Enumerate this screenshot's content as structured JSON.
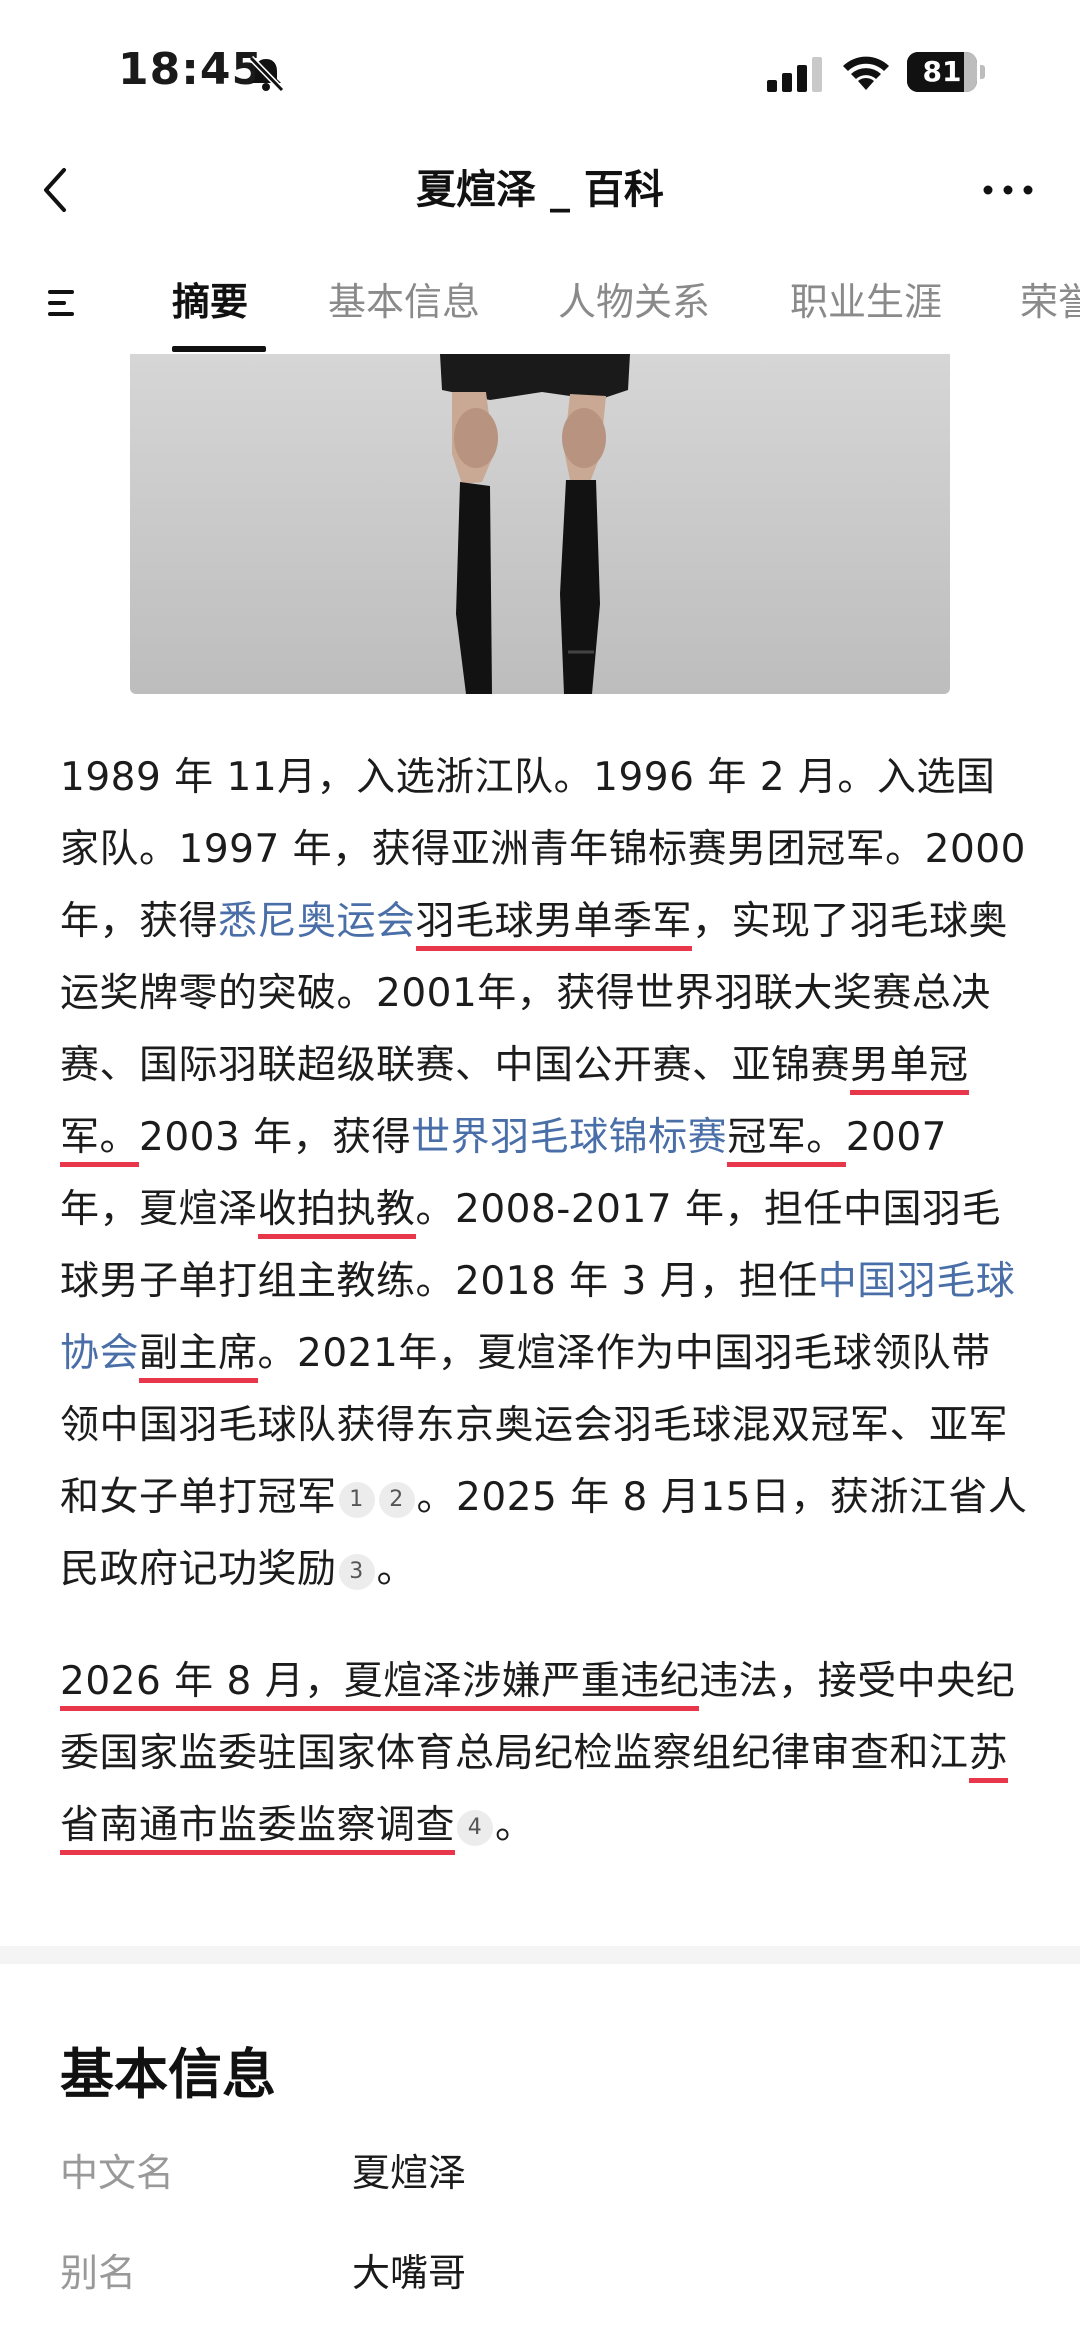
{
  "status_bar": {
    "time": "18:45",
    "battery": "81",
    "battery_level": 0.81,
    "icons": [
      "bell-slash-icon",
      "signal-icon",
      "wifi-icon",
      "battery-icon"
    ]
  },
  "header": {
    "title": "夏煊泽 _ 百科",
    "icons": [
      "back-arrow-icon",
      "more-dots-icon"
    ]
  },
  "tabs": [
    {
      "label": "摘要",
      "active": true
    },
    {
      "label": "基本信息",
      "active": false
    },
    {
      "label": "人物关系",
      "active": false
    },
    {
      "label": "职业生涯",
      "active": false
    },
    {
      "label": "荣誉",
      "active": false
    }
  ],
  "article": {
    "p1": {
      "t1": "1989 年 11月，入选浙江队。1996 年 2 月。入选国家队。1997 年，获得亚洲青年锦标赛男团冠军。2000年，获得",
      "link1": "悉尼奥运会",
      "hl1": "羽毛球男单季军",
      "t2": "，实现了羽毛球奥运奖牌零的突破。2001年，获得世界羽联大奖赛总决赛、国际羽联超级联赛、中国公开赛、亚锦赛",
      "hl2": "男单冠军。",
      "t3": "2003 年，获得",
      "link2": "世界羽毛球锦标赛",
      "hl3": "冠军。",
      "t4": "2007 年，夏煊泽",
      "hl4": "收拍执教",
      "t5": "。2008-2017 年，担任中国羽毛球男子单打组主教练。2018 年 3 月，担任",
      "link3": "中国羽毛球协会",
      "hl5": "副主席",
      "t6": "。2021年，夏煊泽作为中国羽毛球领队带领中国羽毛球队获得东京奥运会羽毛球混双冠军、亚军和女子单打冠军",
      "cite1": "1",
      "cite2": "2",
      "t7": "。2025 年 8 月15日，获浙江省人民政府记功奖励",
      "cite3": "3",
      "t8": "。"
    },
    "p2": {
      "hl1": "2026 年 8 月，夏煊泽涉嫌严重违纪",
      "t1": "违法，接受中央纪委国家监委驻国家体育总局纪检监察组纪律审查和江",
      "hl2": "苏省南通市监委监察调查",
      "cite4": "4",
      "t2": "。"
    }
  },
  "basic_info": {
    "title": "基本信息",
    "rows": [
      {
        "label": "中文名",
        "value": "夏煊泽"
      },
      {
        "label": "别名",
        "value": "大嘴哥"
      }
    ]
  }
}
